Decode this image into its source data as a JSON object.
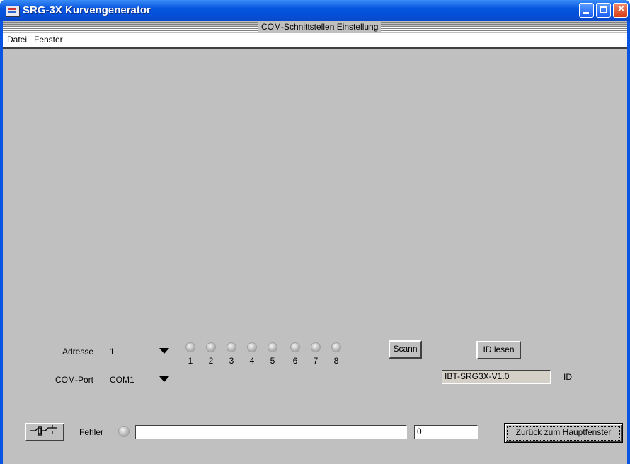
{
  "window": {
    "title": "SRG-3X Kurvengenerator"
  },
  "mdi": {
    "caption": "COM-Schnittstellen Einstellung"
  },
  "menu": {
    "items": [
      "Datei",
      "Fenster"
    ]
  },
  "form": {
    "address_label": "Adresse",
    "address_value": "1",
    "comport_label": "COM-Port",
    "comport_value": "COM1",
    "led_labels": [
      "1",
      "2",
      "3",
      "4",
      "5",
      "6",
      "7",
      "8"
    ],
    "scan_label": "Scann",
    "read_id_label": "ID lesen",
    "id_value": "IBT-SRG3X-V1.0",
    "id_label": "ID"
  },
  "statusbar": {
    "error_label": "Fehler",
    "message_value": "",
    "count_value": "0",
    "back_label_pre": "Zurück zum ",
    "back_label_hotkey": "H",
    "back_label_post": "auptfenster"
  }
}
